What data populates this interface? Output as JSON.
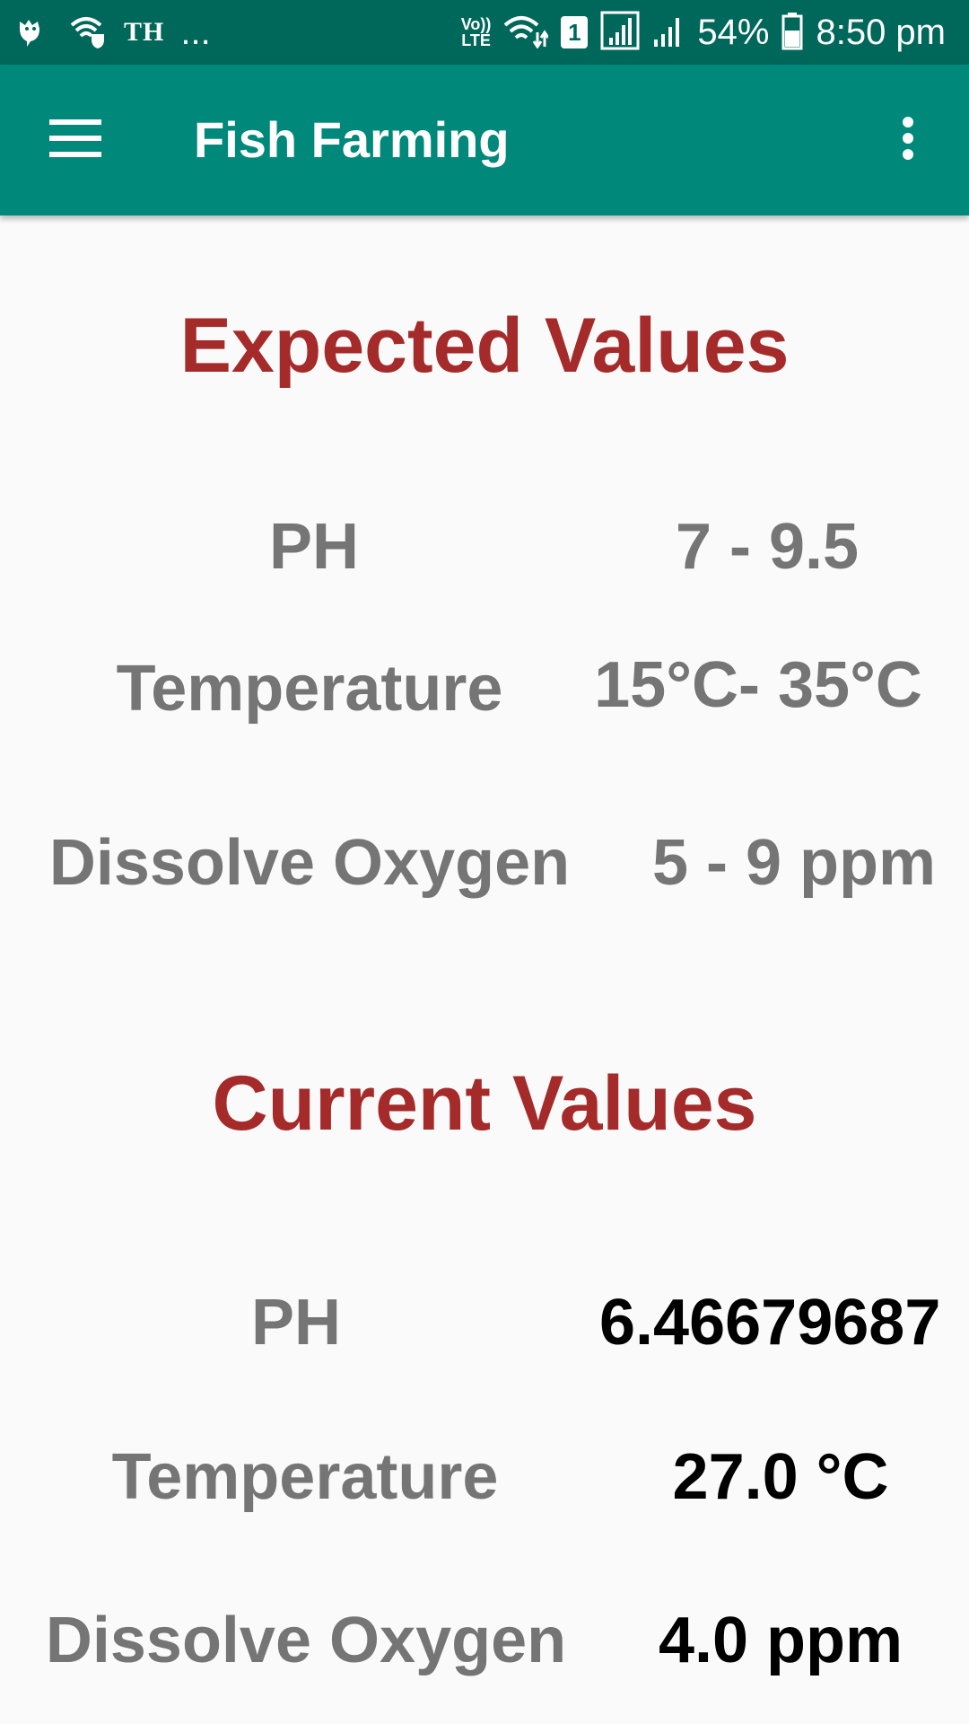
{
  "status_bar": {
    "carrier": "TH",
    "more": "...",
    "volte_top": "Vo))",
    "volte_bottom": "LTE",
    "sim": "1",
    "battery": "54%",
    "time": "8:50 pm",
    "icons": [
      "bird-icon",
      "wifi-shield-icon",
      "volte-icon",
      "wifi-data-icon",
      "sim-icon",
      "signal-icon",
      "signal-icon",
      "battery-icon"
    ]
  },
  "app_bar": {
    "title": "Fish Farming",
    "menu_icon": "hamburger-icon",
    "overflow_icon": "more-vert-icon",
    "color": "#00897b"
  },
  "expected": {
    "title": "Expected Values",
    "rows": [
      {
        "label": "PH",
        "value": "7 - 9.5"
      },
      {
        "label": "Temperature",
        "value": "15°C- 35°C"
      },
      {
        "label": "Dissolve Oxygen",
        "value": "5 - 9 ppm"
      }
    ]
  },
  "current": {
    "title": "Current Values",
    "rows": [
      {
        "label": "PH",
        "value": "6.46679687"
      },
      {
        "label": "Temperature",
        "value": "27.0 °C"
      },
      {
        "label": "Dissolve Oxygen",
        "value": "4.0 ppm"
      }
    ]
  },
  "colors": {
    "section_title": "#a52a2a",
    "label": "#757575",
    "current_value": "#000000"
  }
}
